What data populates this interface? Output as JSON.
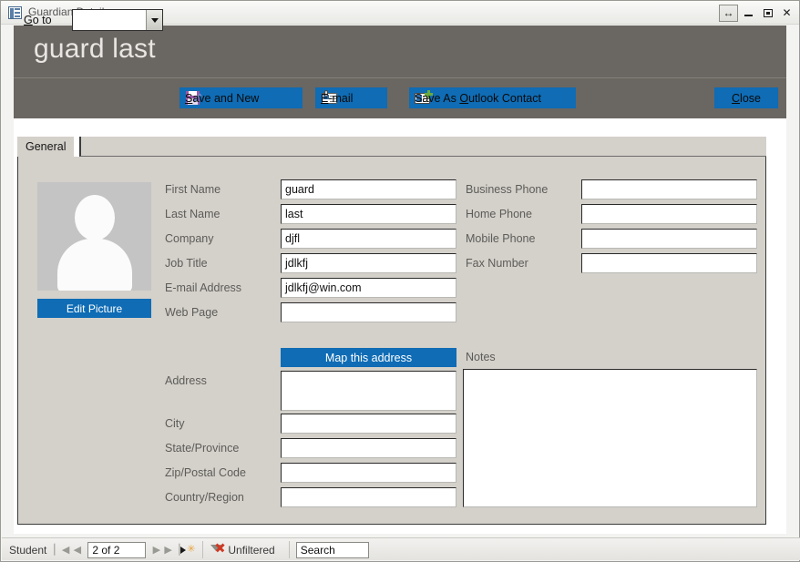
{
  "window": {
    "title": "Guardian Details",
    "icon": "form-icon",
    "controls": [
      {
        "name": "restore-width-button",
        "glyph": "↔"
      },
      {
        "name": "minimize-button",
        "glyph": "–"
      },
      {
        "name": "maximize-button",
        "glyph": "□"
      },
      {
        "name": "close-window-button",
        "glyph": "✕"
      }
    ]
  },
  "header": {
    "title": "guard last",
    "bg": "#6a6661"
  },
  "commandbar": {
    "goto_label_pre": "G",
    "goto_label_post": "o to",
    "goto_value": "",
    "buttons": {
      "save_and_new": {
        "pre": "S",
        "post": "ave and New",
        "icon": "floppy-disk-pencil-icon"
      },
      "email": {
        "pre": "E",
        "post": "-mail",
        "icon": "envelope-paperclip-icon"
      },
      "outlook": {
        "pre_text": "Save As ",
        "pre": "O",
        "post": "utlook Contact",
        "icon": "contact-card-plus-icon"
      },
      "close": {
        "pre": "C",
        "post": "lose"
      }
    },
    "accent": "#0f6cb5"
  },
  "tabs": [
    {
      "label": "General",
      "active": true
    }
  ],
  "picture": {
    "placeholder_icon": "person-silhouette-icon",
    "edit_button": "Edit Picture"
  },
  "form": {
    "left_column": [
      {
        "label": "First Name",
        "value": "guard"
      },
      {
        "label": "Last Name",
        "value": "last"
      },
      {
        "label": "Company",
        "value": "djfl"
      },
      {
        "label": "Job Title",
        "value": "jdlkfj"
      },
      {
        "label": "E-mail Address",
        "value": "jdlkfj@win.com"
      },
      {
        "label": "Web Page",
        "value": ""
      }
    ],
    "right_column": [
      {
        "label": "Business Phone",
        "value": ""
      },
      {
        "label": "Home Phone",
        "value": ""
      },
      {
        "label": "Mobile Phone",
        "value": ""
      },
      {
        "label": "Fax Number",
        "value": ""
      }
    ],
    "map_button": "Map this address",
    "address_column": [
      {
        "label": "Address",
        "value": ""
      },
      {
        "label": "City",
        "value": ""
      },
      {
        "label": "State/Province",
        "value": ""
      },
      {
        "label": "Zip/Postal Code",
        "value": ""
      },
      {
        "label": "Country/Region",
        "value": ""
      }
    ],
    "notes": {
      "label": "Notes",
      "value": ""
    }
  },
  "statusbar": {
    "record_label": "Student",
    "first_glyph": "▏◀",
    "prev_glyph": "◀",
    "record_value": "2 of 2",
    "next_glyph": "▶",
    "last_glyph": "▶▕",
    "new_record_star": "✳",
    "filter_label": "Unfiltered",
    "filter_icon": "filter-removed-icon",
    "search_value": "Search"
  }
}
